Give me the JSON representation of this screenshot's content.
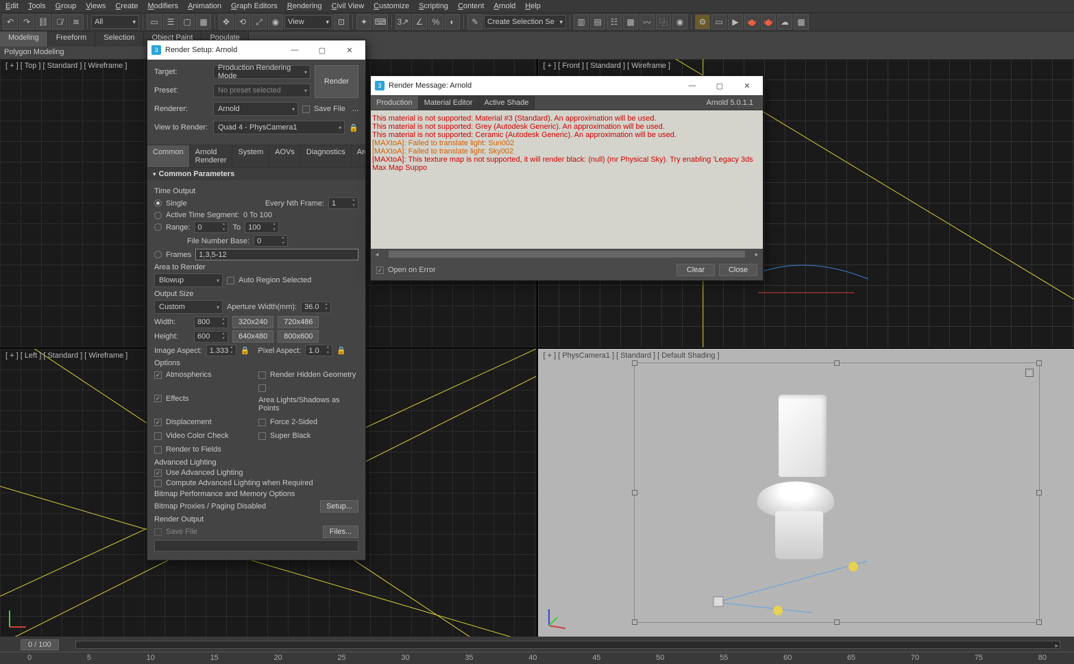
{
  "menubar": [
    "Edit",
    "Tools",
    "Group",
    "Views",
    "Create",
    "Modifiers",
    "Animation",
    "Graph Editors",
    "Rendering",
    "Civil View",
    "Customize",
    "Scripting",
    "Content",
    "Arnold",
    "Help"
  ],
  "toolbar": {
    "all": "All",
    "view": "View",
    "create_sel": "Create Selection Se"
  },
  "ribbon": {
    "tabs": [
      "Modeling",
      "Freeform",
      "Selection",
      "Object Paint",
      "Populate"
    ],
    "sub": "Polygon Modeling"
  },
  "viewports": {
    "tl": "[ + ] [ Top ] [ Standard ] [ Wireframe ]",
    "tr": "[ + ] [ Front ] [ Standard ] [ Wireframe ]",
    "bl": "[ + ] [ Left ] [ Standard ] [ Wireframe ]",
    "br": "[ + ] [ PhysCamera1 ] [ Standard ] [ Default Shading ]"
  },
  "timeline": {
    "frame": "0 / 100",
    "ticks": [
      "0",
      "5",
      "10",
      "15",
      "20",
      "25",
      "30",
      "35",
      "40",
      "45",
      "50",
      "55",
      "60",
      "65",
      "70",
      "75",
      "80"
    ]
  },
  "render_setup": {
    "title": "Render Setup: Arnold",
    "target_l": "Target:",
    "target": "Production Rendering Mode",
    "preset_l": "Preset:",
    "preset": "No preset selected",
    "renderer_l": "Renderer:",
    "renderer": "Arnold",
    "savefile_l": "Save File",
    "view_l": "View to Render:",
    "view": "Quad 4 - PhysCamera1",
    "render_btn": "Render",
    "tabs": [
      "Common",
      "Arnold Renderer",
      "System",
      "AOVs",
      "Diagnostics",
      "Archive"
    ],
    "common_h": "Common Parameters",
    "time_output_h": "Time Output",
    "single": "Single",
    "every_nth": "Every Nth Frame:",
    "every_nth_v": "1",
    "active_seg": "Active Time Segment:",
    "active_seg_v": "0 To 100",
    "range": "Range:",
    "range_a": "0",
    "range_to": "To",
    "range_b": "100",
    "file_num": "File Number Base:",
    "file_num_v": "0",
    "frames": "Frames",
    "frames_v": "1,3,5-12",
    "area_h": "Area to Render",
    "area_v": "Blowup",
    "auto_region": "Auto Region Selected",
    "out_h": "Output Size",
    "out_preset": "Custom",
    "aperture_l": "Aperture Width(mm):",
    "aperture_v": "36.0",
    "width_l": "Width:",
    "width_v": "800",
    "height_l": "Height:",
    "height_v": "600",
    "p1": "320x240",
    "p2": "720x486",
    "p3": "640x480",
    "p4": "800x600",
    "imgasp_l": "Image Aspect:",
    "imgasp_v": "1.333",
    "pixasp_l": "Pixel Aspect:",
    "pixasp_v": "1.0",
    "opts_h": "Options",
    "atmos": "Atmospherics",
    "effects": "Effects",
    "disp": "Displacement",
    "vcc": "Video Color Check",
    "rtf": "Render to Fields",
    "rhg": "Render Hidden Geometry",
    "alsp": "Area Lights/Shadows as Points",
    "f2s": "Force 2-Sided",
    "sblk": "Super Black",
    "advl_h": "Advanced Lighting",
    "ual": "Use Advanced Lighting",
    "calwr": "Compute Advanced Lighting when Required",
    "bmp_h": "Bitmap Performance and Memory Options",
    "bmp_t": "Bitmap Proxies / Paging Disabled",
    "setup_btn": "Setup...",
    "ro_h": "Render Output",
    "ro_save": "Save File",
    "files_btn": "Files...",
    "ellipsis": "..."
  },
  "render_msg": {
    "title": "Render Message: Arnold",
    "tabs": [
      "Production",
      "Material Editor",
      "Active Shade"
    ],
    "version": "Arnold 5.0.1.1",
    "lines": [
      {
        "c": "red",
        "t": "This material is not supported: Material #3 (Standard). An approximation will be used."
      },
      {
        "c": "red",
        "t": "This material is not supported: Grey (Autodesk Generic). An approximation will be used."
      },
      {
        "c": "red",
        "t": "This material is not supported: Ceramic (Autodesk Generic). An approximation will be used."
      },
      {
        "c": "orange",
        "t": "[MAXtoA]: Failed to translate light: Sun002"
      },
      {
        "c": "orange",
        "t": "[MAXtoA]: Failed to translate light: Sky002"
      },
      {
        "c": "red",
        "t": "[MAXtoA]: This texture map is not supported, it will render black: (null) (mr Physical Sky). Try enabling 'Legacy 3ds Max Map Suppo"
      }
    ],
    "open_on_error": "Open on Error",
    "clear": "Clear",
    "close": "Close"
  }
}
